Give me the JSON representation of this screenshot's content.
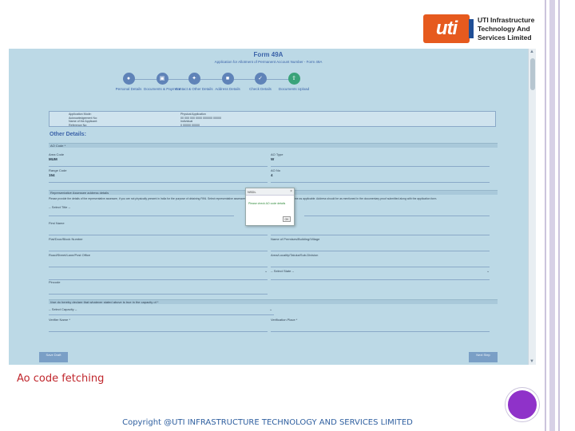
{
  "logo": {
    "mark_text": "uti",
    "company_line1": "UTI Infrastructure",
    "company_line2": "Technology And",
    "company_line3": "Services Limited"
  },
  "form": {
    "title": "Form 49A",
    "subtitle": "Application for Allotment of Permanent Account Number - Form 49A",
    "steps": [
      {
        "label": "Personal Details",
        "icon": "person-icon"
      },
      {
        "label": "Documents & Payment",
        "icon": "document-icon"
      },
      {
        "label": "Contact & Other Details",
        "icon": "contact-icon"
      },
      {
        "label": "Address Details",
        "icon": "address-icon"
      },
      {
        "label": "Check Details",
        "icon": "check-icon"
      },
      {
        "label": "Documents Upload",
        "icon": "upload-icon"
      }
    ],
    "info": [
      {
        "label": "Application Mode:",
        "value": "Physical Application"
      },
      {
        "label": "Acknowledgement No:",
        "value": "00 000 000 0000 000000 00000"
      },
      {
        "label": "Name of the Applicant:",
        "value": "Individual"
      },
      {
        "label": "Reference No:",
        "value": "0 00000 00000"
      }
    ],
    "section_title": "Other Details:",
    "ao_code_bar": "AO Code *",
    "fields": {
      "area_code_label": "Area Code",
      "area_code_value": "MUM",
      "ao_type_label": "AO Type",
      "ao_type_value": "W",
      "range_code_label": "Range Code",
      "range_code_value": "154",
      "ao_no_label": "AO No",
      "ao_no_value": "4"
    },
    "rep_bar": "Representative Assessee address details",
    "rep_para": "Please provide the details of the representative assessee, if you are not physically present in India for the purpose of obtaining PAN. Select representative assessee title, first name, middle name and last name as applicable. Address should be as mentioned in the documentary proof submitted along with the application form.",
    "select_title": "-- Select Title --",
    "first_name_label": "First Name",
    "flat_label": "Flat/Door/Block Number",
    "premises_label": "Name of Premises/Building/Village",
    "road_label": "Road/Street/Lane/Post Office",
    "area_label": "Area/Locality/Taluka/Sub-Division",
    "select_state": "-- Select State --",
    "pincode_label": "Pincode",
    "declare_bar": "I/we do hereby declare that whatever stated above is true in the capacity of *",
    "select_capacity": "-- Select Capacity --",
    "verifier_label": "Verifier Name *",
    "verify_place_label": "Verification Place *",
    "nav_prev": "Save Draft",
    "nav_next": "Next Step"
  },
  "popup": {
    "title": "NSDL",
    "message": "Please check AO code details",
    "ok_label": "OK"
  },
  "caption": "Ao code fetching",
  "copyright": "Copyright @UTI INFRASTRUCTURE TECHNOLOGY AND SERVICES LIMITED"
}
